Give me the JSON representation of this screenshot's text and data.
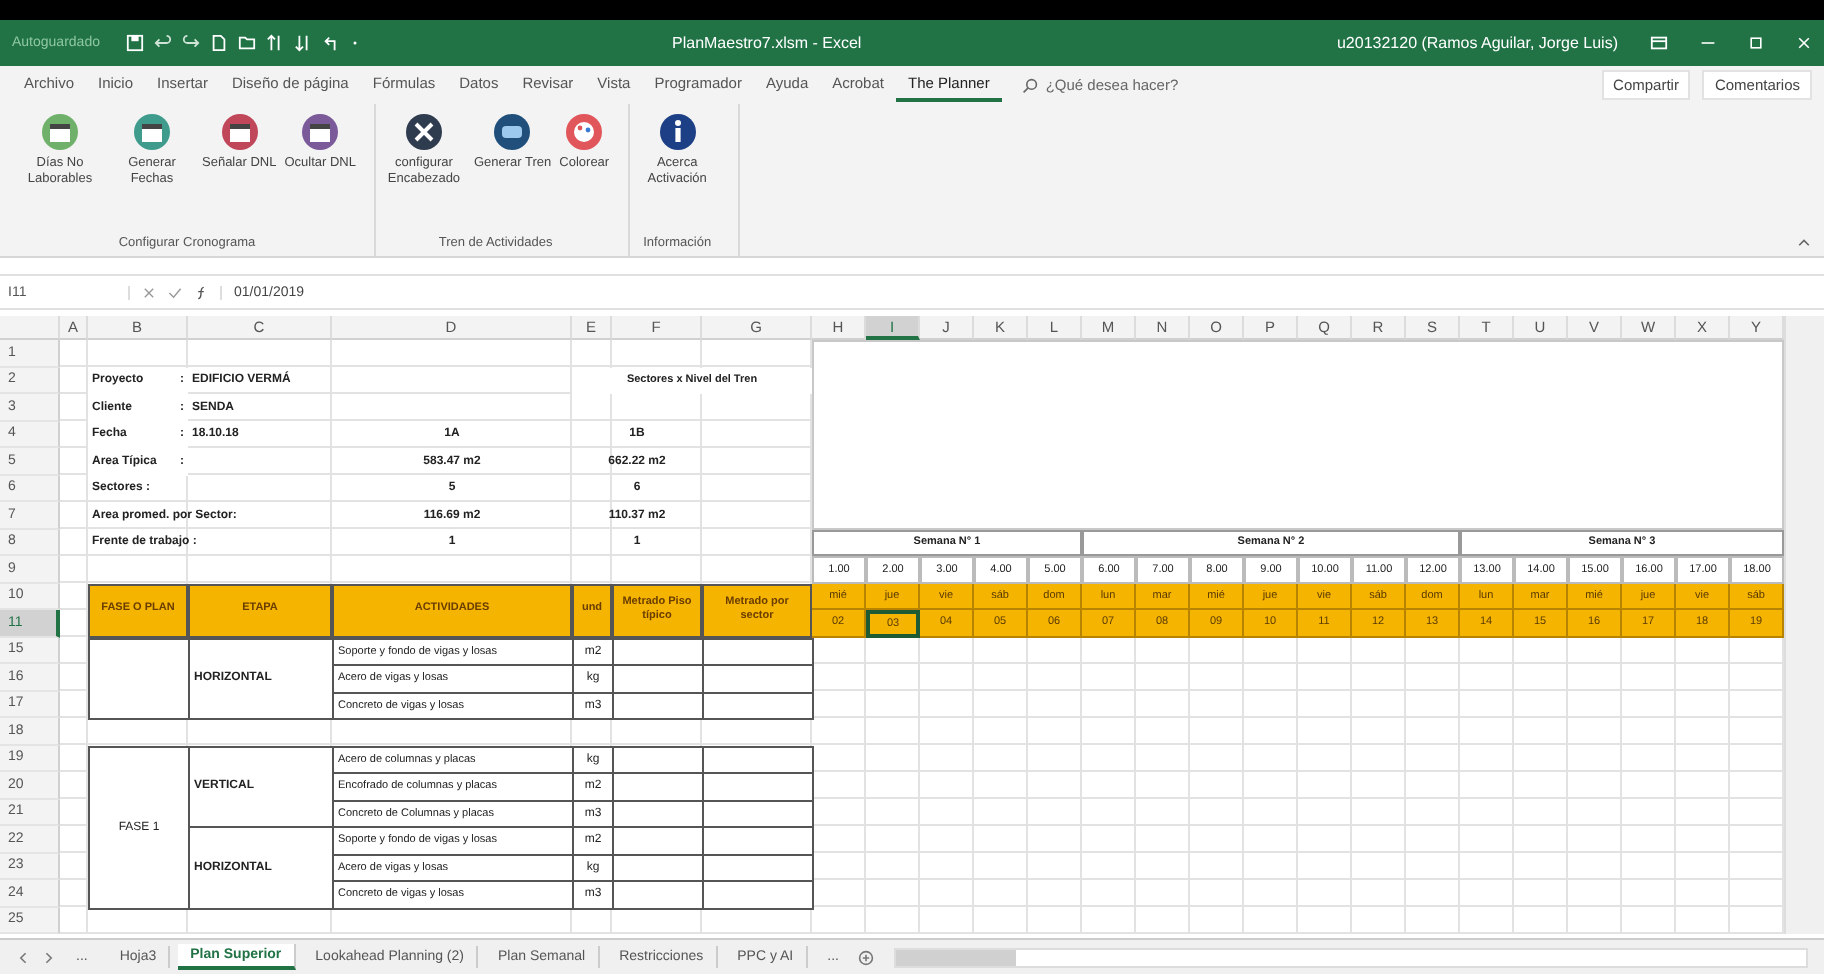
{
  "title_bar": {
    "autosave_label": "Autoguardado",
    "title": "PlanMaestro7.xlsm - Excel",
    "user": "u20132120 (Ramos Aguilar, Jorge Luis)"
  },
  "ribbon_tabs": [
    {
      "label": "Archivo",
      "selected": false
    },
    {
      "label": "Inicio",
      "selected": false
    },
    {
      "label": "Insertar",
      "selected": false
    },
    {
      "label": "Diseño de página",
      "selected": false
    },
    {
      "label": "Fórmulas",
      "selected": false
    },
    {
      "label": "Datos",
      "selected": false
    },
    {
      "label": "Revisar",
      "selected": false
    },
    {
      "label": "Vista",
      "selected": false
    },
    {
      "label": "Programador",
      "selected": false
    },
    {
      "label": "Ayuda",
      "selected": false
    },
    {
      "label": "Acrobat",
      "selected": false
    },
    {
      "label": "The Planner",
      "selected": true
    }
  ],
  "tell_me": {
    "placeholder": "¿Qué desea hacer?"
  },
  "share_button": "Compartir",
  "comments_button": "Comentarios",
  "ribbon_groups": [
    {
      "label": "Configurar Cronograma",
      "buttons": [
        {
          "label": "Días No Laborables",
          "kind": "nonworking"
        },
        {
          "label": "Generar Fechas",
          "kind": "dates"
        },
        {
          "label": "Señalar DNL",
          "kind": "mark"
        },
        {
          "label": "Ocultar DNL",
          "kind": "hide"
        }
      ]
    },
    {
      "label": "Tren de Actividades",
      "buttons": [
        {
          "label": "configurar Encabezado",
          "kind": "tools"
        },
        {
          "label": "Generar Tren",
          "kind": "train"
        },
        {
          "label": "Colorear",
          "kind": "palette"
        }
      ]
    },
    {
      "label": "Información",
      "buttons": [
        {
          "label": "Acerca Activación",
          "kind": "info"
        }
      ]
    }
  ],
  "formula_bar": {
    "name_box": "I11",
    "formula": "01/01/2019"
  },
  "column_headers": [
    {
      "label": "A",
      "selected": false
    },
    {
      "label": "B",
      "selected": false
    },
    {
      "label": "C",
      "selected": false
    },
    {
      "label": "D",
      "selected": false
    },
    {
      "label": "E",
      "selected": false
    },
    {
      "label": "F",
      "selected": false
    },
    {
      "label": "G",
      "selected": false
    },
    {
      "label": "H",
      "selected": false
    },
    {
      "label": "I",
      "selected": true
    },
    {
      "label": "J",
      "selected": false
    },
    {
      "label": "K",
      "selected": false
    },
    {
      "label": "L",
      "selected": false
    },
    {
      "label": "M",
      "selected": false
    },
    {
      "label": "N",
      "selected": false
    },
    {
      "label": "O",
      "selected": false
    },
    {
      "label": "P",
      "selected": false
    },
    {
      "label": "Q",
      "selected": false
    },
    {
      "label": "R",
      "selected": false
    },
    {
      "label": "S",
      "selected": false
    },
    {
      "label": "T",
      "selected": false
    },
    {
      "label": "U",
      "selected": false
    },
    {
      "label": "V",
      "selected": false
    },
    {
      "label": "W",
      "selected": false
    },
    {
      "label": "X",
      "selected": false
    },
    {
      "label": "Y",
      "selected": false
    }
  ],
  "row_headers": [
    {
      "label": "1",
      "selected": false
    },
    {
      "label": "2",
      "selected": false
    },
    {
      "label": "3",
      "selected": false
    },
    {
      "label": "4",
      "selected": false
    },
    {
      "label": "5",
      "selected": false
    },
    {
      "label": "6",
      "selected": false
    },
    {
      "label": "7",
      "selected": false
    },
    {
      "label": "8",
      "selected": false
    },
    {
      "label": "9",
      "selected": false
    },
    {
      "label": "10",
      "selected": false
    },
    {
      "label": "11",
      "selected": true
    },
    {
      "label": "15",
      "selected": false
    },
    {
      "label": "16",
      "selected": false
    },
    {
      "label": "17",
      "selected": false
    },
    {
      "label": "18",
      "selected": false
    },
    {
      "label": "19",
      "selected": false
    },
    {
      "label": "20",
      "selected": false
    },
    {
      "label": "21",
      "selected": false
    },
    {
      "label": "22",
      "selected": false
    },
    {
      "label": "23",
      "selected": false
    },
    {
      "label": "24",
      "selected": false
    },
    {
      "label": "25",
      "selected": false
    }
  ],
  "project_info": {
    "towers_note": "Sectores x Nivel del Tren",
    "items": [
      {
        "label": "Proyecto",
        "colon": ":",
        "value": "EDIFICIO VERMÁ"
      },
      {
        "label": "Cliente",
        "colon": ":",
        "value": "SENDA"
      },
      {
        "label": "Fecha",
        "colon": ":",
        "value": "18.10.18",
        "tower_1": "1A",
        "tower_2": "1B"
      },
      {
        "label": "Area Típica",
        "colon": ":",
        "tower_1": "583.47 m2",
        "tower_2": "662.22 m2"
      },
      {
        "label": "Sectores :",
        "tower_1": "5",
        "tower_2": "6"
      },
      {
        "label": "Area promed. por Sector:",
        "tower_1": "116.69 m2",
        "tower_2": "110.37 m2"
      },
      {
        "label": "Frente de trabajo :",
        "tower_1": "1",
        "tower_2": "1"
      }
    ]
  },
  "activities_table": {
    "headers": [
      "FASE O PLAN",
      "ETAPA",
      "ACTIVIDADES",
      "und",
      "Metrado Piso típico",
      "Metrado por sector"
    ],
    "groups": [
      {
        "stages": [
          {
            "name": "HORIZONTAL",
            "activities": [
              {
                "name": "Soporte y fondo de vigas y losas",
                "unit": "m2"
              },
              {
                "name": "Acero de vigas y losas",
                "unit": "kg"
              },
              {
                "name": "Concreto de vigas y losas",
                "unit": "m3"
              }
            ]
          }
        ]
      },
      {
        "phase": "FASE 1",
        "stages": [
          {
            "name": "VERTICAL",
            "activities": [
              {
                "name": "Acero de columnas y placas",
                "unit": "kg"
              },
              {
                "name": "Encofrado de columnas y placas",
                "unit": "m2"
              },
              {
                "name": "Concreto de Columnas y placas",
                "unit": "m3"
              }
            ]
          },
          {
            "name": "HORIZONTAL",
            "activities": [
              {
                "name": "Soporte y fondo de vigas y losas",
                "unit": "m2"
              },
              {
                "name": "Acero de vigas y losas",
                "unit": "kg"
              },
              {
                "name": "Concreto de vigas y losas",
                "unit": "m3"
              }
            ]
          }
        ]
      }
    ]
  },
  "schedule": {
    "weeks": [
      {
        "label": "Semana N° 1",
        "days": [
          {
            "number": "1.00",
            "day": "mié",
            "date": "02",
            "selected": false
          },
          {
            "number": "2.00",
            "day": "jue",
            "date": "03",
            "selected": true
          },
          {
            "number": "3.00",
            "day": "vie",
            "date": "04",
            "selected": false
          },
          {
            "number": "4.00",
            "day": "sáb",
            "date": "05",
            "selected": false
          },
          {
            "number": "5.00",
            "day": "dom",
            "date": "06",
            "selected": false
          }
        ]
      },
      {
        "label": "Semana N° 2",
        "days": [
          {
            "number": "6.00",
            "day": "lun",
            "date": "07",
            "selected": false
          },
          {
            "number": "7.00",
            "day": "mar",
            "date": "08",
            "selected": false
          },
          {
            "number": "8.00",
            "day": "mié",
            "date": "09",
            "selected": false
          },
          {
            "number": "9.00",
            "day": "jue",
            "date": "10",
            "selected": false
          },
          {
            "number": "10.00",
            "day": "vie",
            "date": "11",
            "selected": false
          },
          {
            "number": "11.00",
            "day": "sáb",
            "date": "12",
            "selected": false
          },
          {
            "number": "12.00",
            "day": "dom",
            "date": "13",
            "selected": false
          }
        ]
      },
      {
        "label": "Semana N° 3",
        "days": [
          {
            "number": "13.00",
            "day": "lun",
            "date": "14",
            "selected": false
          },
          {
            "number": "14.00",
            "day": "mar",
            "date": "15",
            "selected": false
          },
          {
            "number": "15.00",
            "day": "mié",
            "date": "16",
            "selected": false
          },
          {
            "number": "16.00",
            "day": "jue",
            "date": "17",
            "selected": false
          },
          {
            "number": "17.00",
            "day": "vie",
            "date": "18",
            "selected": false
          },
          {
            "number": "18.00",
            "day": "sáb",
            "date": "19",
            "selected": false
          }
        ]
      }
    ]
  },
  "sheet_tabs": [
    {
      "label": "Hoja3",
      "selected": false
    },
    {
      "label": "Plan Superior",
      "selected": true
    },
    {
      "label": "Lookahead Planning (2)",
      "selected": false
    },
    {
      "label": "Plan Semanal",
      "selected": false
    },
    {
      "label": "Restricciones",
      "selected": false
    },
    {
      "label": "PPC y AI",
      "selected": false
    }
  ],
  "sheet_nav": {
    "more_left": "...",
    "more_right": "..."
  }
}
